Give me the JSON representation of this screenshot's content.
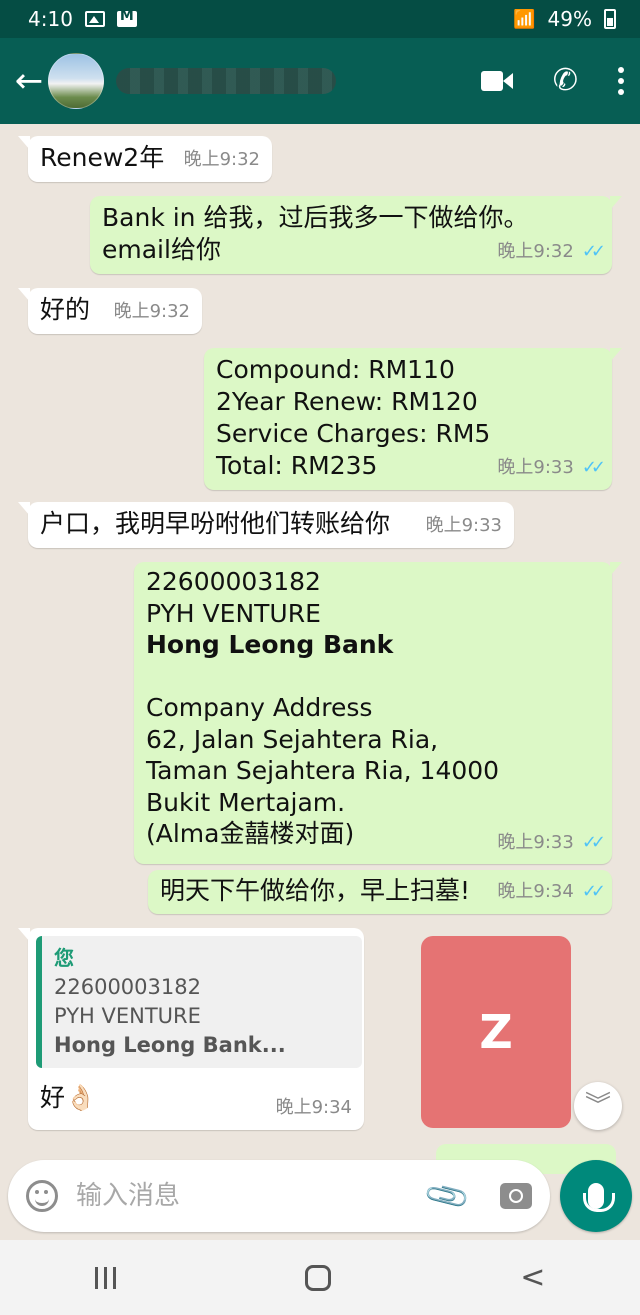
{
  "status_bar": {
    "time": "4:10",
    "battery": "49%"
  },
  "header": {
    "contact_name": ""
  },
  "messages": [
    {
      "dir": "in",
      "text": "Renew2年",
      "time": "晚上9:32"
    },
    {
      "dir": "out",
      "lines": [
        "Bank in 给我，过后我多一下做给你。",
        "email给你"
      ],
      "time": "晚上9:32"
    },
    {
      "dir": "in",
      "text": "好的",
      "time": "晚上9:32"
    },
    {
      "dir": "out",
      "lines": [
        "Compound: RM110",
        "2Year Renew: RM120",
        "Service Charges: RM5",
        "Total: RM235"
      ],
      "time": "晚上9:33"
    },
    {
      "dir": "in",
      "text": "户口，我明早吩咐他们转账给你",
      "time": "晚上9:33"
    },
    {
      "dir": "out",
      "lines": [
        "22600003182",
        "PYH VENTURE",
        "Hong Leong Bank",
        "",
        "Company Address",
        "62, Jalan Sejahtera Ria,",
        "Taman Sejahtera Ria, 14000",
        "Bukit Mertajam.",
        "(Alma金囍楼对面)"
      ],
      "time": "晚上9:33"
    },
    {
      "dir": "out",
      "text": "明天下午做给你，早上扫墓!",
      "time": "晚上9:34"
    },
    {
      "dir": "in",
      "quote": {
        "author": "您",
        "lines": [
          "22600003182",
          "PYH VENTURE",
          "Hong Leong Bank..."
        ]
      },
      "text": "好👌🏻",
      "time": "晚上9:34"
    }
  ],
  "sticker": {
    "label": "Z"
  },
  "input": {
    "placeholder": "输入消息"
  }
}
